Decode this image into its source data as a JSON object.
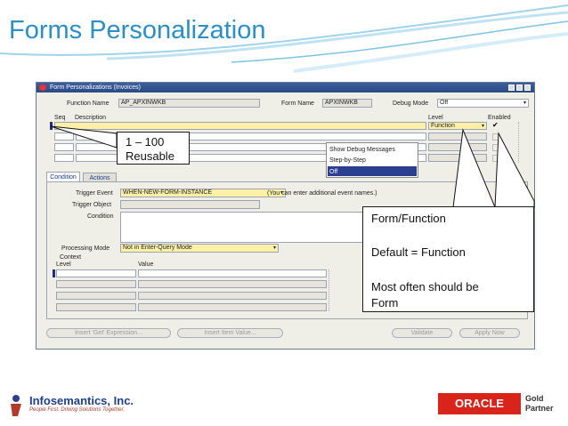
{
  "slide": {
    "title": "Forms Personalization"
  },
  "window": {
    "title": "Form Personalizations (Invoices)",
    "function_name_label": "Function Name",
    "function_name_value": "AP_APXINWKB",
    "form_name_label": "Form Name",
    "form_name_value": "APXINWKB",
    "debug_mode_label": "Debug Mode",
    "debug_mode_value": "Off",
    "columns": {
      "seq": "Seq",
      "description": "Description",
      "level": "Level",
      "enabled": "Enabled"
    },
    "first_row_level": "Function",
    "debug_options": [
      "Show Debug Messages",
      "Step-by-Step",
      "Off"
    ],
    "tabs": [
      "Condition",
      "Actions"
    ],
    "trigger_event_label": "Trigger Event",
    "trigger_event_value": "WHEN-NEW-FORM-INSTANCE",
    "trigger_event_hint": "(You can enter additional event names.)",
    "trigger_object_label": "Trigger Object",
    "condition_label": "Condition",
    "processing_mode_label": "Processing Mode",
    "processing_mode_value": "Not in Enter-Query Mode",
    "context_label": "Context",
    "context_level_label": "Level",
    "context_value_label": "Value",
    "buttons": {
      "insert_get": "Insert 'Get' Expression...",
      "insert_item": "Insert Item Value...",
      "validate": "Validate",
      "apply_now": "Apply Now"
    }
  },
  "callouts": {
    "seq": {
      "line1": "1 – 100",
      "line2": "Reusable"
    },
    "level": {
      "line1": "Form/Function",
      "line2": "Default = Function",
      "line3": "Most often should be",
      "line4": "Form"
    }
  },
  "logos": {
    "infosemantics": "Infosemantics, Inc.",
    "infosemantics_tagline": "People First. Driving Solutions Together.",
    "oracle": "ORACLE",
    "partner_line1": "Gold",
    "partner_line2": "Partner"
  },
  "colors": {
    "title_blue": "#2a8fc6",
    "window_title_bar": "#2a4a86",
    "required_yellow": "#fbf0a6",
    "oracle_red": "#d9241c"
  }
}
